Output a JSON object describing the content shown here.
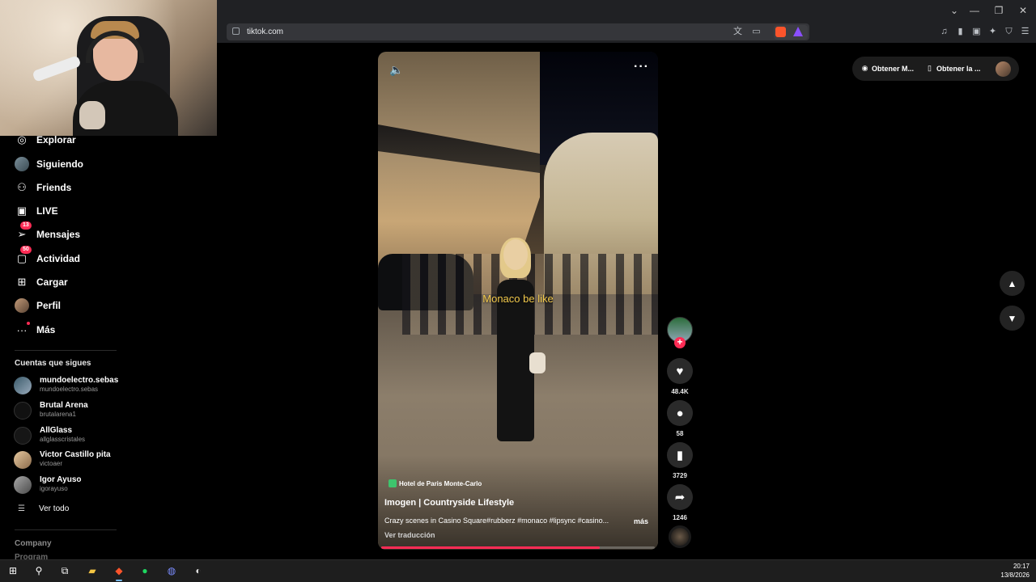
{
  "browser": {
    "url": "tiktok.com",
    "window_controls": {
      "minimize": "—",
      "restore": "❐",
      "close": "✕"
    }
  },
  "sidebar": {
    "nav": [
      {
        "label": "Explorar",
        "icon": "compass-icon"
      },
      {
        "label": "Siguiendo",
        "icon": "avatar"
      },
      {
        "label": "Friends",
        "icon": "friends-icon"
      },
      {
        "label": "LIVE",
        "icon": "live-icon"
      },
      {
        "label": "Mensajes",
        "icon": "messages-icon",
        "badge": "13"
      },
      {
        "label": "Actividad",
        "icon": "activity-icon",
        "badge": "50"
      },
      {
        "label": "Cargar",
        "icon": "upload-icon"
      },
      {
        "label": "Perfil",
        "icon": "profile-avatar"
      },
      {
        "label": "Más",
        "icon": "more-icon"
      }
    ],
    "following_title": "Cuentas que sigues",
    "accounts": [
      {
        "name": "mundoelectro.sebas",
        "handle": "mundoelectro.sebas"
      },
      {
        "name": "Brutal Arena",
        "handle": "brutalarena1"
      },
      {
        "name": "AllGlass",
        "handle": "allglasscristales"
      },
      {
        "name": "Victor Castillo pita",
        "handle": "victoaer"
      },
      {
        "name": "Igor Ayuso",
        "handle": "igorayuso"
      }
    ],
    "see_all": "Ver todo",
    "company": "Company",
    "program": "Program"
  },
  "video": {
    "caption_overlay": "Monaco be like",
    "location": "Hotel de Paris Monte-Carlo",
    "author": "Imogen | Countryside Lifestyle",
    "description": "Crazy scenes in Casino Square#rubberz #monaco #lipsync #casino...",
    "more": "más",
    "translate": "Ver traducción",
    "progress": 0.8
  },
  "actions": {
    "likes": "48.4K",
    "comments": "58",
    "saves": "3729",
    "shares": "1246"
  },
  "top_right": {
    "get_coins": "Obtener M...",
    "get_app": "Obtener la ..."
  },
  "taskbar": {
    "time": "20:17",
    "date": "13/8/2026"
  }
}
